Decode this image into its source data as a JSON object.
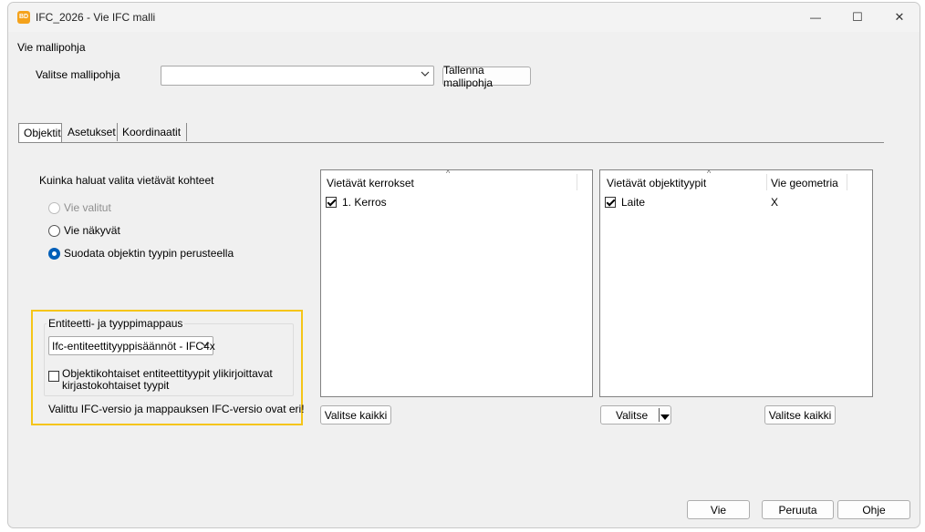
{
  "window": {
    "app_icon_text": "BD",
    "title": "IFC_2026 - Vie IFC malli",
    "minimize_glyph": "—",
    "maximize_glyph": "☐",
    "close_glyph": "✕"
  },
  "template": {
    "section_label": "Vie mallipohja",
    "select_label": "Valitse mallipohja",
    "combo_value": "",
    "save_button": "Tallenna mallipohja"
  },
  "tabs": [
    {
      "label": "Objektit",
      "active": true
    },
    {
      "label": "Asetukset",
      "active": false
    },
    {
      "label": "Koordinaatit",
      "active": false
    }
  ],
  "selection": {
    "question": "Kuinka haluat valita vietävät kohteet",
    "options": [
      {
        "label": "Vie valitut",
        "enabled": false,
        "selected": false
      },
      {
        "label": "Vie näkyvät",
        "enabled": true,
        "selected": false
      },
      {
        "label": "Suodata objektin tyypin perusteella",
        "enabled": true,
        "selected": true
      }
    ]
  },
  "mapping": {
    "group_label": "Entiteetti- ja tyyppimappaus",
    "combo_value": "Ifc-entiteettityyppisäännöt - IFC4x",
    "override_label_line1": "Objektikohtaiset entiteettityypit ylikirjoittavat",
    "override_label_line2": "kirjastokohtaiset tyypit",
    "override_checked": false,
    "warning": "Valittu IFC-versio ja mappauksen IFC-versio ovat eri!"
  },
  "floors": {
    "header": "Vietävät kerrokset",
    "items": [
      {
        "label": "1. Kerros",
        "checked": true
      }
    ],
    "select_all": "Valitse kaikki"
  },
  "types": {
    "header_type": "Vietävät objektityypit",
    "header_geometry": "Vie geometria",
    "items": [
      {
        "label": "Laite",
        "checked": true,
        "geometry": "X"
      }
    ],
    "select_button": "Valitse",
    "select_all": "Valitse kaikki"
  },
  "footer": {
    "export": "Vie",
    "cancel": "Peruuta",
    "help": "Ohje"
  },
  "colors": {
    "highlight_border": "#f5c518",
    "accent": "#005fb8"
  }
}
